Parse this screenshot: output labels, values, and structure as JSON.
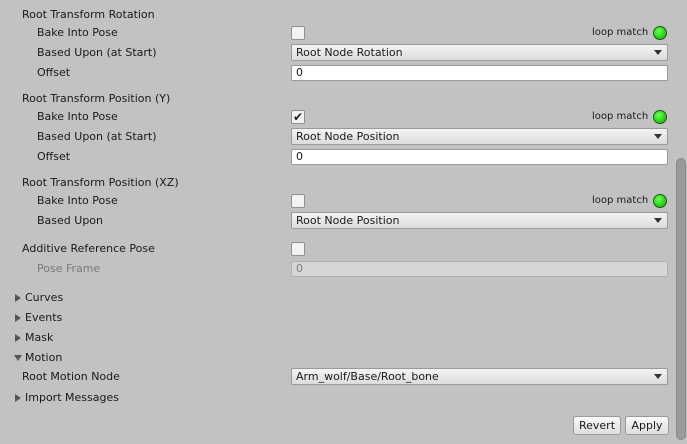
{
  "rotation": {
    "header": "Root Transform Rotation",
    "bake_label": "Bake Into Pose",
    "bake_checked": false,
    "loop_label": "loop match",
    "based_label": "Based Upon (at Start)",
    "based_value": "Root Node Rotation",
    "offset_label": "Offset",
    "offset_value": "0"
  },
  "position_y": {
    "header": "Root Transform Position (Y)",
    "bake_label": "Bake Into Pose",
    "bake_checked": true,
    "bake_check_glyph": "✔",
    "loop_label": "loop match",
    "based_label": "Based Upon (at Start)",
    "based_value": "Root Node Position",
    "offset_label": "Offset",
    "offset_value": "0"
  },
  "position_xz": {
    "header": "Root Transform Position (XZ)",
    "bake_label": "Bake Into Pose",
    "bake_checked": false,
    "loop_label": "loop match",
    "based_label": "Based Upon",
    "based_value": "Root Node Position"
  },
  "additive": {
    "label": "Additive Reference Pose",
    "checked": false,
    "pose_frame_label": "Pose Frame",
    "pose_frame_value": "0"
  },
  "foldouts": {
    "curves": "Curves",
    "events": "Events",
    "mask": "Mask",
    "motion": "Motion",
    "import_messages": "Import Messages"
  },
  "motion": {
    "root_node_label": "Root Motion Node",
    "root_node_value": "Arm_wolf/Base/Root_bone"
  },
  "buttons": {
    "revert": "Revert",
    "apply": "Apply"
  },
  "colors": {
    "background": "#c2c2c2",
    "loop_match_ok": "#2fd41e"
  },
  "icons": {
    "loop_match": "green-status-dot-icon",
    "dropdown": "caret-down-icon",
    "collapsed": "triangle-right-icon",
    "expanded": "triangle-down-icon"
  }
}
